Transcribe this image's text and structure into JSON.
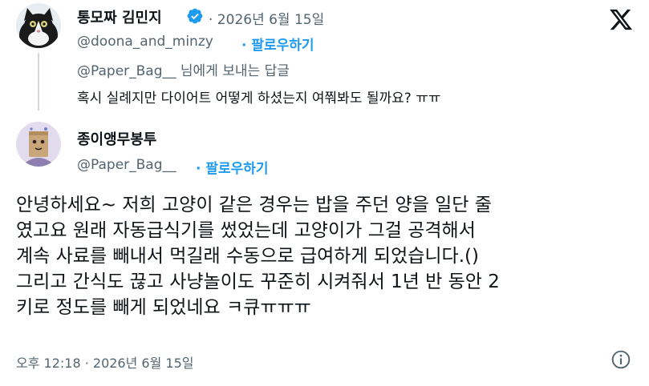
{
  "quoted": {
    "name": "통모짜 김민지",
    "date": "· 2026년 6월 15일",
    "handle": "@doona_and_minzy",
    "follow": "· 팔로우하기",
    "replying_to": "@Paper_Bag__ 님에게 보내는 답글",
    "text": "혹시 실례지만 다이어트 어떻게 하셨는지 여쭤봐도 될까요? ㅠㅠ"
  },
  "post": {
    "name": "종이앵무봉투",
    "handle": "@Paper_Bag__",
    "follow": "· 팔로우하기",
    "text": "안녕하세요~ 저희 고양이 같은 경우는 밥을 주던 양을 일단 줄\n였고요 원래 자동급식기를 썼었는데 고양이가 그걸 공격해서\n계속 사료를  빼내서 먹길래 수동으로 급여하게 되었습니다.()\n그리고 간식도 끊고 사냥놀이도 꾸준히 시켜줘서 1년 반 동안 2\n키로 정도를 빼게 되었네요 ㅋ큐ㅠㅠㅠ",
    "timestamp": "오후 12:18 · 2026년 6월 15일"
  },
  "icons": {
    "verified": "verified-badge-icon",
    "x_logo": "x-logo-icon",
    "info": "info-icon"
  },
  "colors": {
    "accent": "#1d9bf0",
    "muted": "#536471",
    "text": "#0f1419"
  }
}
